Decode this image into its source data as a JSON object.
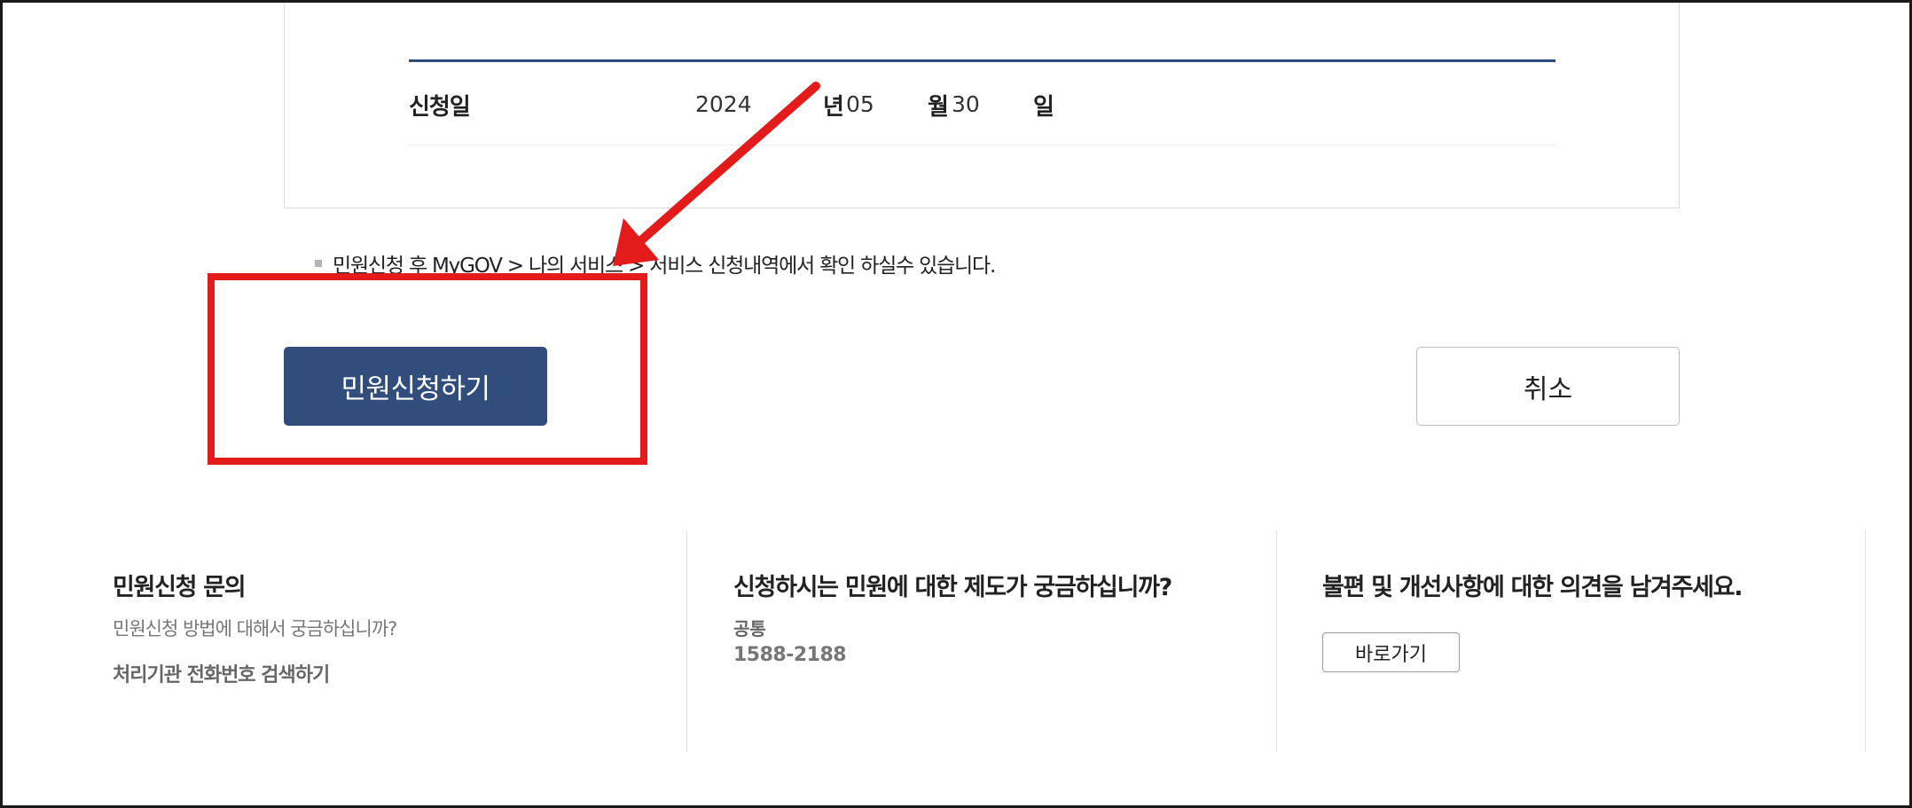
{
  "form": {
    "label": "신청일",
    "year": "2024",
    "year_unit": "년",
    "month": "05",
    "month_unit": "월",
    "day": "30",
    "day_unit": "일"
  },
  "notice": "민원신청 후 MyGOV > 나의 서비스 > 서비스 신청내역에서 확인 하실수 있습니다.",
  "buttons": {
    "submit": "민원신청하기",
    "cancel": "취소"
  },
  "info": {
    "inquiry": {
      "title": "민원신청 문의",
      "subtitle": "민원신청 방법에 대해서 궁금하십니까?",
      "link": "처리기관 전화번호 검색하기"
    },
    "system": {
      "title": "신청하시는 민원에 대한 제도가 궁금하십니까?",
      "label": "공통",
      "phone": "1588-2188"
    },
    "feedback": {
      "title": "불편 및 개선사항에 대한 의견을 남겨주세요.",
      "button": "바로가기"
    }
  },
  "colors": {
    "primary_button": "#314d7b",
    "annotation": "#e31b1b",
    "divider_accent": "#2e4a7a"
  },
  "icons": {
    "notice_bullet": "square-bullet-icon",
    "annotation_arrow": "red-arrow-icon"
  }
}
